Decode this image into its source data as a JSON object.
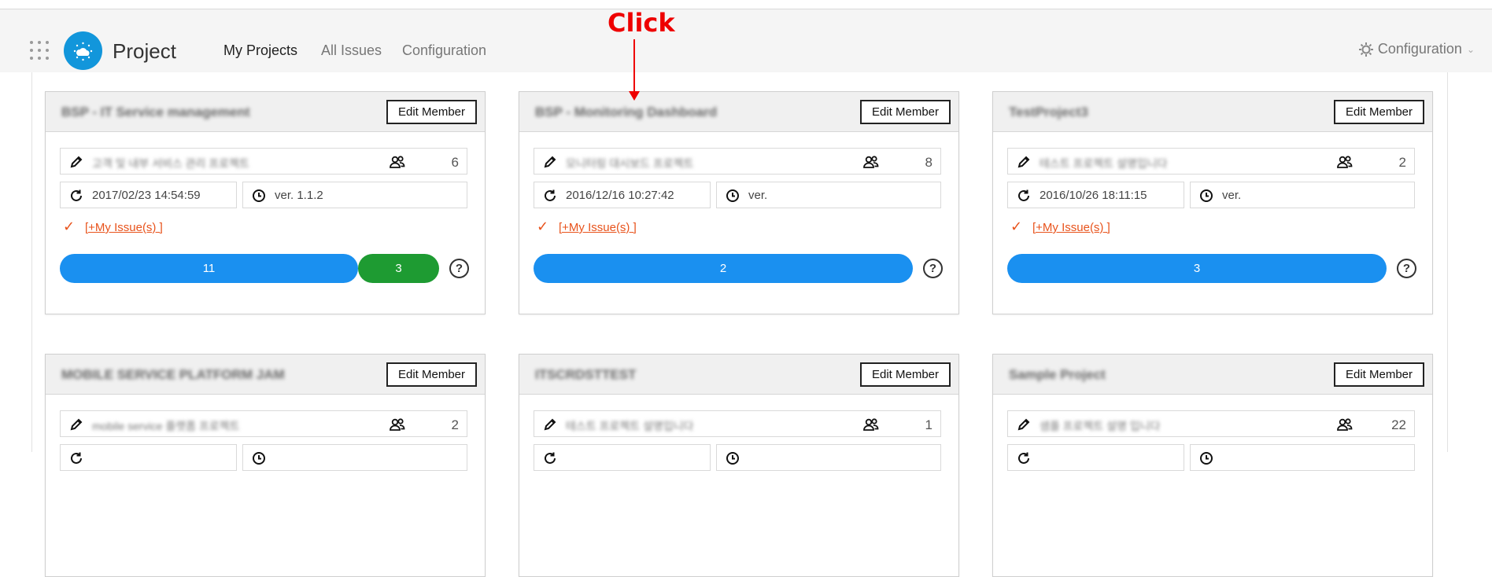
{
  "header": {
    "app_title": "Project",
    "nav": [
      {
        "label": "My Projects",
        "active": true
      },
      {
        "label": "All Issues",
        "active": false
      },
      {
        "label": "Configuration",
        "active": false
      }
    ],
    "config_right": "Configuration"
  },
  "annotation": {
    "label": "Click",
    "color": "#ee0000"
  },
  "colors": {
    "accent": "#1296db",
    "bar_blue": "#1a90f0",
    "bar_green": "#1e9b32",
    "issue_orange": "#e8531c"
  },
  "cards": [
    {
      "name": "BSP - IT Service management",
      "edit_label": "Edit Member",
      "description": "고객 및 내부 서비스 관리 프로젝트",
      "member_count": "6",
      "updated": "2017/02/23 14:54:59",
      "version": "ver. 1.1.2",
      "issues_label": "[+My Issue(s) ]",
      "bars": [
        {
          "value": "11",
          "color": "blue"
        },
        {
          "value": "3",
          "color": "green"
        }
      ],
      "help": "?"
    },
    {
      "name": "BSP - Monitoring Dashboard",
      "edit_label": "Edit Member",
      "description": "모니터링 대시보드 프로젝트",
      "member_count": "8",
      "updated": "2016/12/16 10:27:42",
      "version": "ver.",
      "issues_label": "[+My Issue(s) ]",
      "bars": [
        {
          "value": "2",
          "color": "blue"
        }
      ],
      "help": "?"
    },
    {
      "name": "TestProject3",
      "edit_label": "Edit Member",
      "description": "테스트 프로젝트 설명입니다",
      "member_count": "2",
      "updated": "2016/10/26 18:11:15",
      "version": "ver.",
      "issues_label": "[+My Issue(s) ]",
      "bars": [
        {
          "value": "3",
          "color": "blue"
        }
      ],
      "help": "?"
    },
    {
      "name": "MOBILE SERVICE PLATFORM JAM",
      "edit_label": "Edit Member",
      "description": "mobile service 플랫폼 프로젝트",
      "member_count": "2"
    },
    {
      "name": "ITSCRDSTTEST",
      "edit_label": "Edit Member",
      "description": "테스트 프로젝트 설명입니다",
      "member_count": "1"
    },
    {
      "name": "Sample Project",
      "edit_label": "Edit Member",
      "description": "샘플 프로젝트 설명 입니다",
      "member_count": "22"
    }
  ]
}
